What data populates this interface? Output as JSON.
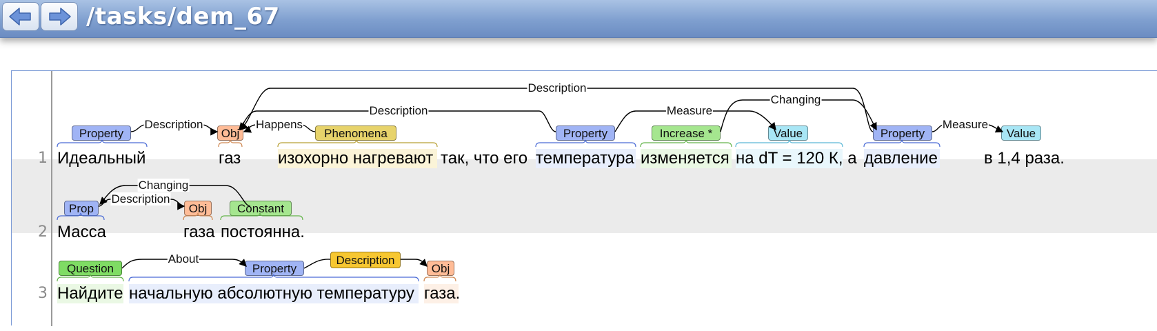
{
  "toolbar": {
    "back_icon": "arrow-left-icon",
    "forward_icon": "arrow-right-icon",
    "title": "/tasks/dem_67"
  },
  "colors": {
    "Property": "#a0b4f5",
    "Obj": "#ffbc97",
    "Phenomena": "#e7d36b",
    "Increase": "#a5e68f",
    "Value": "#a8e6f5",
    "Constant": "#a5e68f",
    "Question": "#7fdc64",
    "Description": "#f7c731"
  },
  "rows": [
    {
      "num": "1",
      "tokens": [
        "Идеальный",
        "газ",
        "изохорно нагревают",
        "так, что его",
        "температура",
        "изменяется",
        "на dT = 120 К, а",
        "давление",
        "в 1,4 раза."
      ],
      "spans": [
        {
          "label": "Property",
          "type": "Property"
        },
        {
          "label": "Obj",
          "type": "Obj"
        },
        {
          "label": "Phenomena",
          "type": "Phenomena"
        },
        {
          "label": "Property",
          "type": "Property"
        },
        {
          "label": "Increase *",
          "type": "Increase"
        },
        {
          "label": "Value",
          "type": "Value"
        },
        {
          "label": "Property",
          "type": "Property"
        },
        {
          "label": "Value",
          "type": "Value"
        }
      ],
      "arcs": [
        "Description",
        "Happens",
        "Description",
        "Description",
        "Measure",
        "Changing",
        "Measure"
      ]
    },
    {
      "num": "2",
      "tokens": [
        "Масса",
        "газа",
        "постоянна."
      ],
      "spans": [
        {
          "label": "Prop",
          "type": "Property"
        },
        {
          "label": "Obj",
          "type": "Obj"
        },
        {
          "label": "Constant",
          "type": "Constant"
        }
      ],
      "arcs": [
        "Changing",
        "Description"
      ]
    },
    {
      "num": "3",
      "tokens": [
        "Найдите",
        "начальную абсолютную температуру",
        "газа."
      ],
      "spans": [
        {
          "label": "Question",
          "type": "Question"
        },
        {
          "label": "Property",
          "type": "Property"
        },
        {
          "label": "Description",
          "type": "Description"
        },
        {
          "label": "Obj",
          "type": "Obj"
        }
      ],
      "arcs": [
        "About"
      ]
    }
  ]
}
